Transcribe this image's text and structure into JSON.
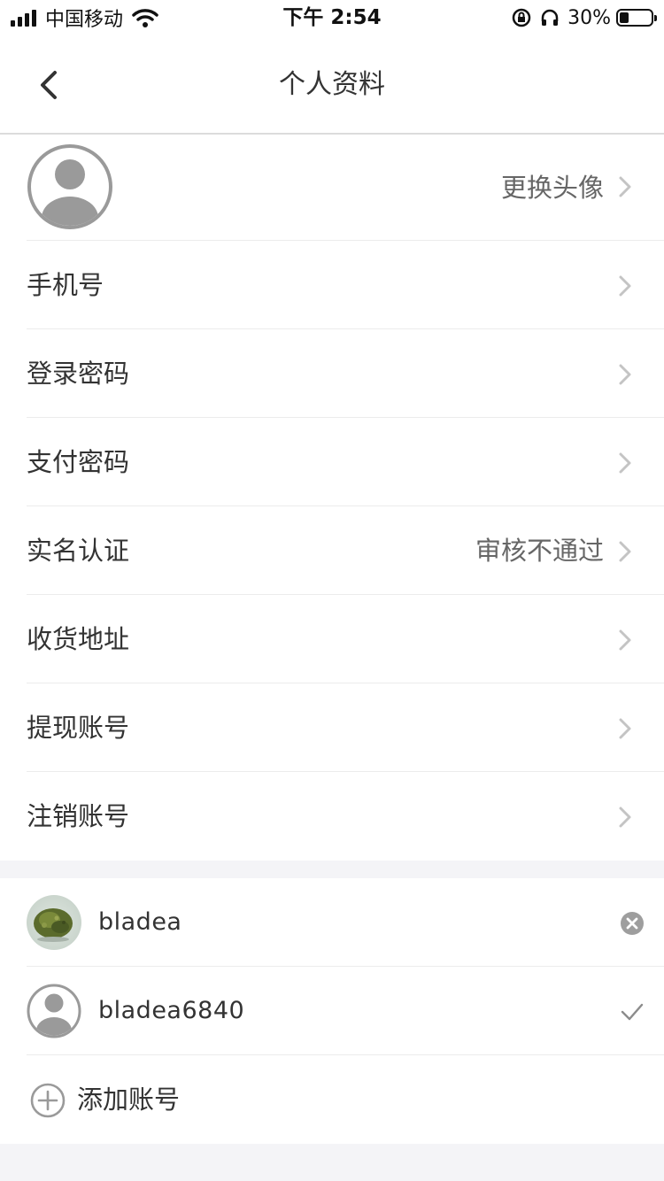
{
  "status_bar": {
    "carrier": "中国移动",
    "time": "下午 2:54",
    "battery_percent": "30%",
    "battery_level": 0.3
  },
  "nav": {
    "title": "个人资料",
    "back_icon": "chevron-left-icon"
  },
  "profile": {
    "avatar_action": "更换头像",
    "rows": [
      {
        "label": "手机号",
        "value": ""
      },
      {
        "label": "登录密码",
        "value": ""
      },
      {
        "label": "支付密码",
        "value": ""
      },
      {
        "label": "实名认证",
        "value": "审核不通过"
      },
      {
        "label": "收货地址",
        "value": ""
      },
      {
        "label": "提现账号",
        "value": ""
      },
      {
        "label": "注销账号",
        "value": ""
      }
    ]
  },
  "accounts": {
    "items": [
      {
        "name": "bladea",
        "end_icon": "remove-circle-icon"
      },
      {
        "name": "bladea6840",
        "end_icon": "checkmark-icon"
      }
    ],
    "add_label": "添加账号"
  },
  "colors": {
    "text_primary": "#333333",
    "text_secondary": "#666666",
    "chevron": "#c4c4c4",
    "divider": "#ececec",
    "background": "#f4f4f7"
  }
}
